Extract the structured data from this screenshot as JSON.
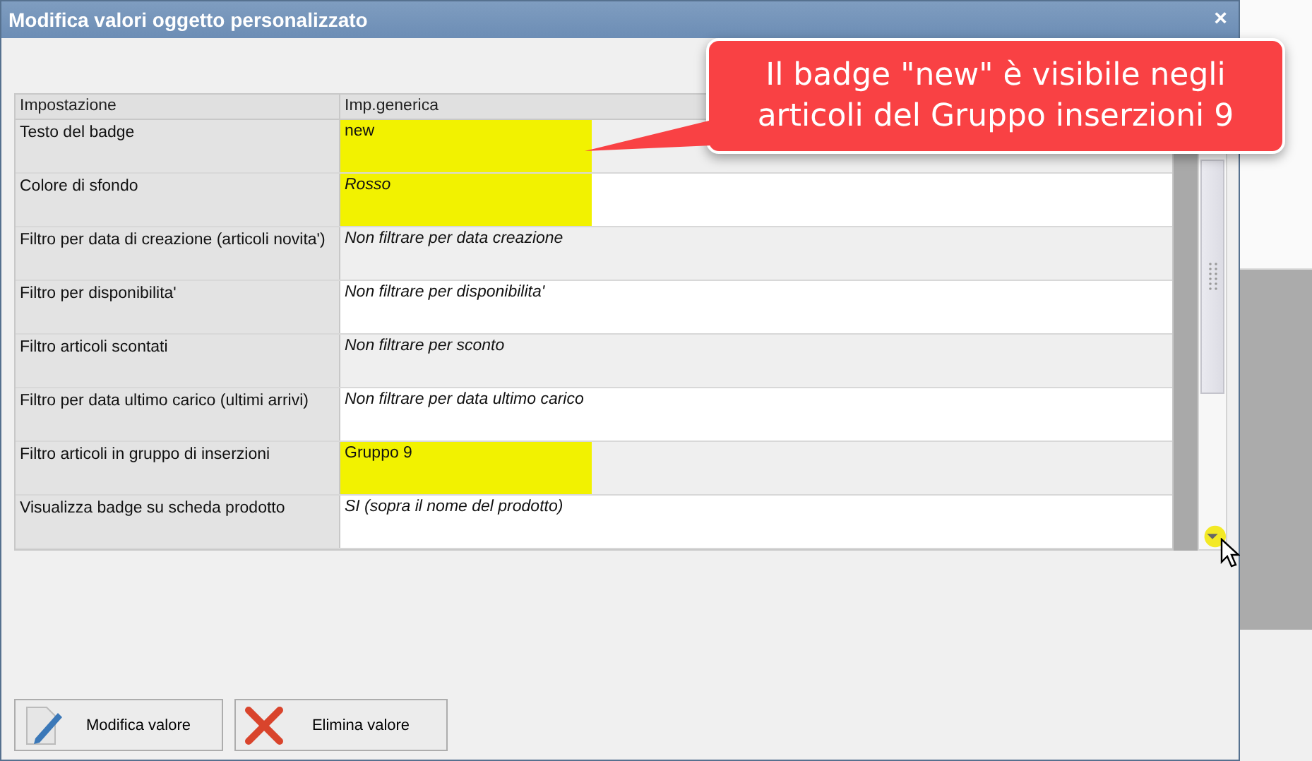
{
  "window": {
    "title": "Modifica valori oggetto personalizzato",
    "close": "×"
  },
  "table": {
    "columns": [
      "Impostazione",
      "Imp.generica"
    ],
    "rows": [
      {
        "setting": "Testo del badge",
        "value": "new",
        "kind": "text",
        "highlighted": true
      },
      {
        "setting": "Colore di sfondo",
        "value": "Rosso",
        "kind": "choice",
        "highlighted": true
      },
      {
        "setting": "Filtro per data di creazione (articoli novita')",
        "value": "Non filtrare per data creazione",
        "kind": "choice",
        "highlighted": false
      },
      {
        "setting": "Filtro per disponibilita'",
        "value": "Non filtrare per disponibilita'",
        "kind": "choice",
        "highlighted": false
      },
      {
        "setting": "Filtro articoli scontati",
        "value": "Non filtrare per sconto",
        "kind": "choice",
        "highlighted": false
      },
      {
        "setting": "Filtro per data ultimo carico (ultimi arrivi)",
        "value": "Non filtrare per data ultimo carico",
        "kind": "choice",
        "highlighted": false
      },
      {
        "setting": "Filtro articoli in gruppo di inserzioni",
        "value": "Gruppo 9",
        "kind": "text",
        "highlighted": true
      },
      {
        "setting": "Visualizza badge su scheda prodotto",
        "value": "SI (sopra il nome del prodotto)",
        "kind": "choice",
        "highlighted": false
      }
    ]
  },
  "buttons": [
    {
      "label": "Modifica valore",
      "kind": "edit"
    },
    {
      "label": "Elimina valore",
      "kind": "delete"
    }
  ],
  "callout": {
    "text": "Il badge \"new\" è visibile negli articoli del Gruppo inserzioni 9"
  }
}
